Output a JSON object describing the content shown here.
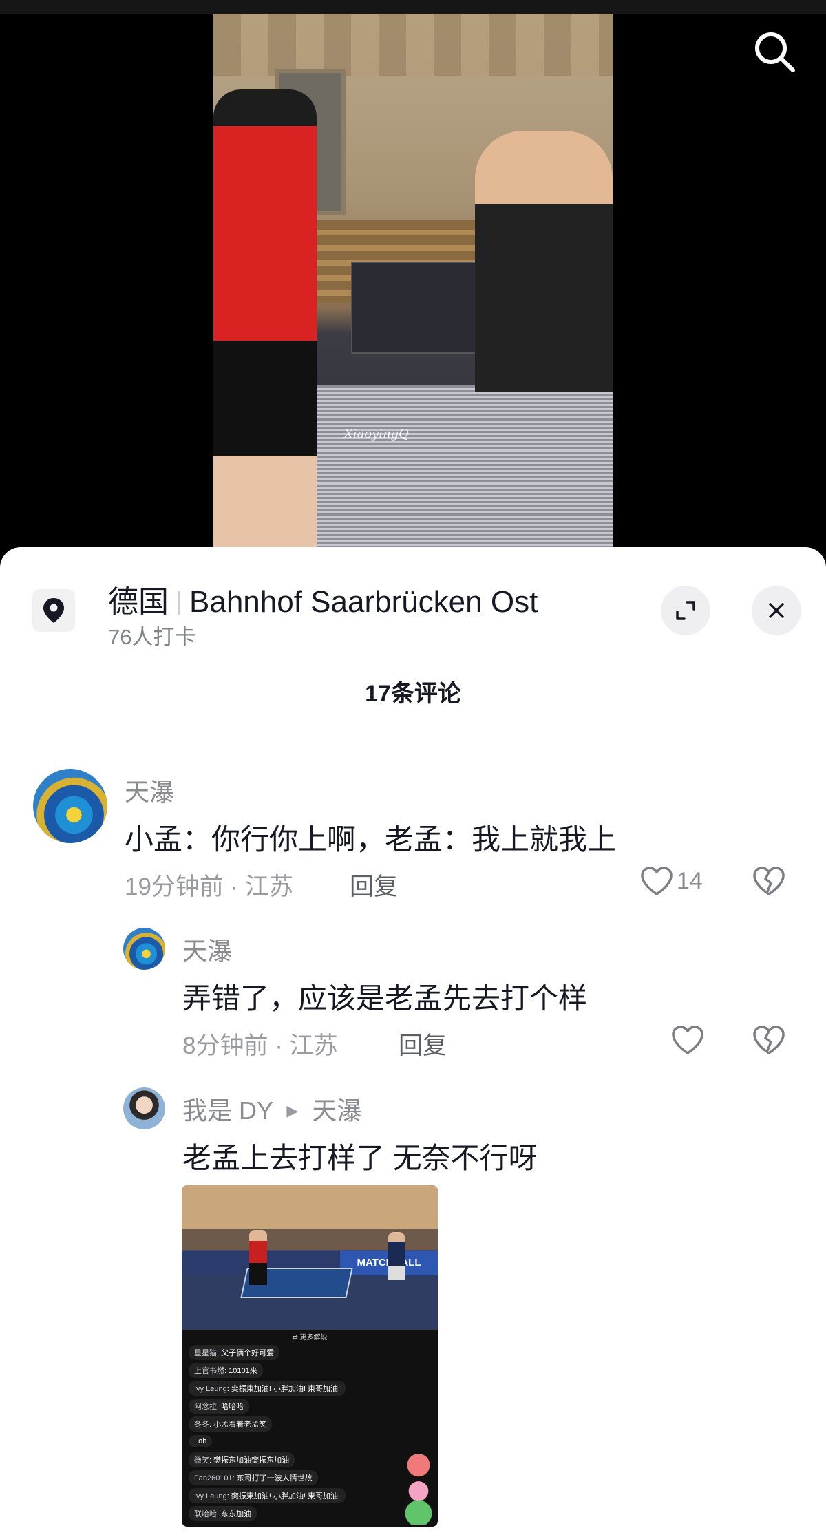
{
  "video": {
    "watermark": "XiaoyingQ"
  },
  "location": {
    "country": "德国",
    "place": "Bahnhof Saarbrücken Ost",
    "checkins": "76人打卡"
  },
  "comments_header": {
    "count_label": "17条评论"
  },
  "comments": [
    {
      "user": "天瀑",
      "text": "小孟：你行你上啊，老孟：我上就我上",
      "time": "19分钟前",
      "region": "江苏",
      "reply_label": "回复",
      "likes": "14"
    },
    {
      "user": "天瀑",
      "text": "弄错了，应该是老孟先去打个样",
      "time": "8分钟前",
      "region": "江苏",
      "reply_label": "回复",
      "likes": ""
    },
    {
      "user": "我是 DY",
      "reply_to": "天瀑",
      "text": "老孟上去打样了 无奈不行呀"
    }
  ],
  "attached_image": {
    "ad_text": "MATCHBALL",
    "interpret_label": "⇄ 更多解说",
    "chat": [
      {
        "user": "星星猫",
        "text": "父子俩个好可爱"
      },
      {
        "user": "上官书燃",
        "text": "10101来"
      },
      {
        "user": "Ivy Leung",
        "text": "樊振東加油! 小胖加油! 東哥加油!"
      },
      {
        "user": "阿念拉",
        "text": "哈哈哈"
      },
      {
        "user": "冬冬",
        "text": "小孟看着老孟笑"
      },
      {
        "user": "",
        "text": "oh"
      },
      {
        "user": "微笑",
        "text": "樊振东加油樊振东加油"
      },
      {
        "user": "Fan260101",
        "text": "东哥打了一波人情世故"
      },
      {
        "user": "Ivy Leung",
        "text": "樊振東加油! 小胖加油! 東哥加油!"
      },
      {
        "user": "联哈哈",
        "text": "东东加油"
      }
    ]
  },
  "colors": {
    "accent_text": "#161823",
    "muted_text": "#8a8b91",
    "sheet_bg": "#ffffff"
  }
}
